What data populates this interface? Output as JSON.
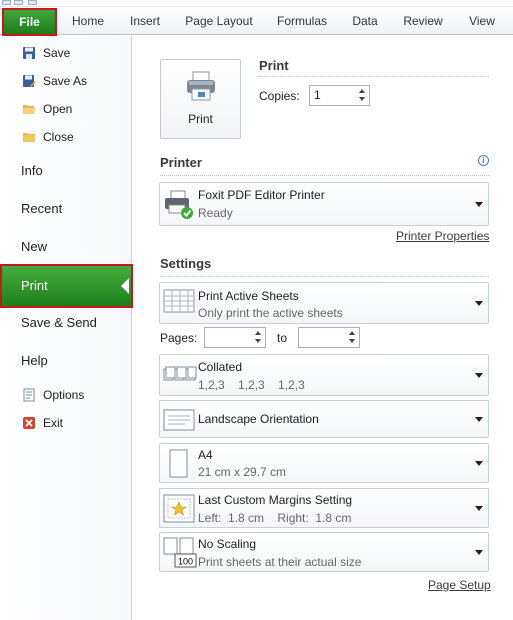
{
  "ribbon": {
    "file": "File",
    "tabs": [
      "Home",
      "Insert",
      "Page Layout",
      "Formulas",
      "Data",
      "Review",
      "View"
    ]
  },
  "nav": {
    "save": "Save",
    "save_as": "Save As",
    "open": "Open",
    "close": "Close",
    "info": "Info",
    "recent": "Recent",
    "new": "New",
    "print": "Print",
    "save_send": "Save & Send",
    "help": "Help",
    "options": "Options",
    "exit": "Exit"
  },
  "print": {
    "heading": "Print",
    "button_label": "Print",
    "copies_label": "Copies:",
    "copies_value": "1"
  },
  "printer": {
    "heading": "Printer",
    "name": "Foxit PDF Editor Printer",
    "status": "Ready",
    "properties_link": "Printer Properties"
  },
  "settings": {
    "heading": "Settings",
    "sheets": {
      "title": "Print Active Sheets",
      "subtitle": "Only print the active sheets"
    },
    "pages_label": "Pages:",
    "to_label": "to",
    "collated": {
      "title": "Collated",
      "subtitle": "1,2,3    1,2,3    1,2,3"
    },
    "orientation": {
      "title": "Landscape Orientation"
    },
    "paper": {
      "title": "A4",
      "subtitle": "21 cm x 29.7 cm"
    },
    "margins": {
      "title": "Last Custom Margins Setting",
      "subtitle": "Left:  1.8 cm    Right:  1.8 cm"
    },
    "scaling": {
      "title": "No Scaling",
      "subtitle": "Print sheets at their actual size",
      "icon_text": "100"
    },
    "page_setup_link": "Page Setup"
  },
  "colors": {
    "file_green": "#2a8f25",
    "highlight_red": "#c8181e"
  }
}
